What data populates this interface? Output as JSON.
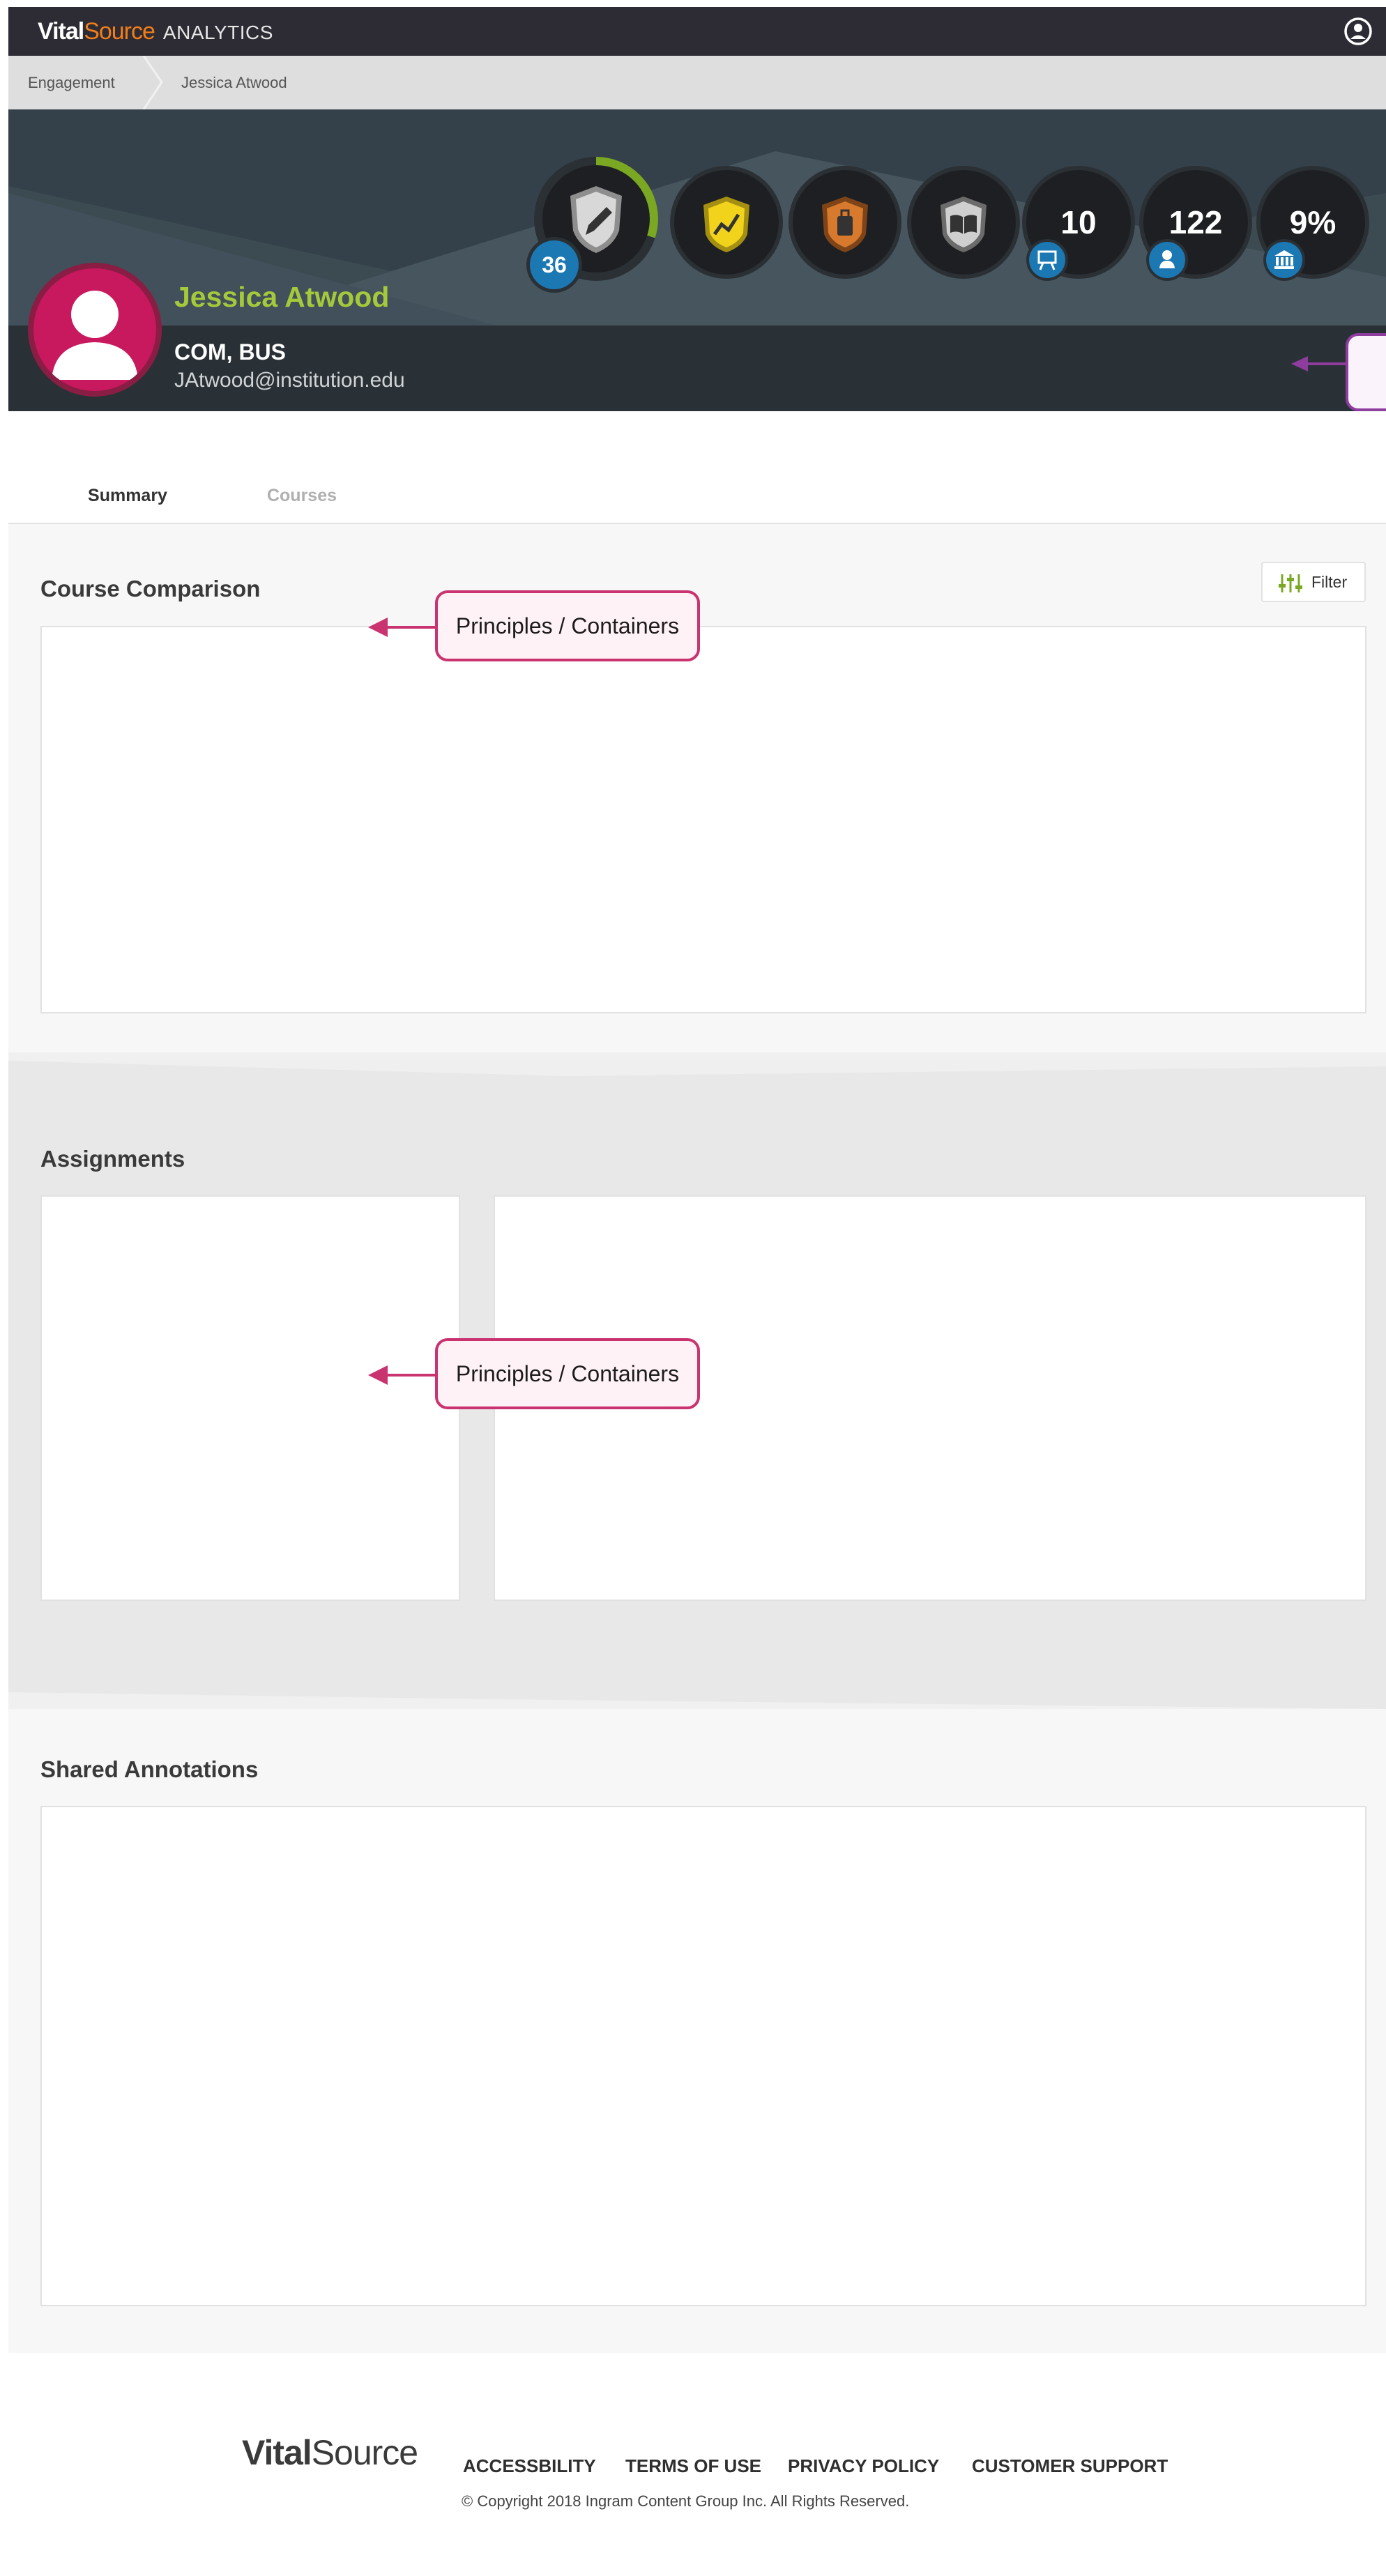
{
  "app": {
    "brand_vital": "Vital",
    "brand_source": "Source",
    "brand_suffix": "ANALYTICS"
  },
  "breadcrumb": {
    "items": [
      "Engagement",
      "Jessica Atwood"
    ]
  },
  "profile": {
    "name": "Jessica Atwood",
    "departments": "COM, BUS",
    "email": "JAtwood@institution.edu",
    "level": "36",
    "level_progress_pct": 30,
    "stats": {
      "courses": "10",
      "users": "122",
      "institution_pct": "9%"
    }
  },
  "tabs": [
    {
      "label": "Summary",
      "active": true
    },
    {
      "label": "Courses",
      "active": false
    }
  ],
  "sections": {
    "course_comparison": {
      "title": "Course Comparison",
      "filter_label": "Filter"
    },
    "assignments": {
      "title": "Assignments"
    },
    "shared_annotations": {
      "title": "Shared Annotations"
    }
  },
  "callouts": {
    "course_comparison": "Principles / Containers",
    "assignments": "Principles / Containers"
  },
  "footer": {
    "brand_vital": "Vital",
    "brand_source": "Source",
    "links": [
      "ACCESSBILITY",
      "TERMS OF USE",
      "PRIVACY POLICY",
      "CUSTOMER SUPPORT"
    ],
    "copyright": "© Copyright 2018 Ingram Content Group Inc. All Rights Reserved."
  },
  "colors": {
    "accent_green": "#7aa823",
    "name_green": "#a4c93a",
    "brand_orange": "#f07e1b",
    "avatar_pink": "#c8185e",
    "callout_pink": "#c9336f",
    "badge_blue": "#1b78b3"
  },
  "icons": [
    "account-circle-icon",
    "pencil-shield-icon",
    "chart-shield-icon",
    "bag-shield-icon",
    "book-shield-icon",
    "presentation-icon",
    "user-icon",
    "institution-icon",
    "filter-sliders-icon"
  ]
}
